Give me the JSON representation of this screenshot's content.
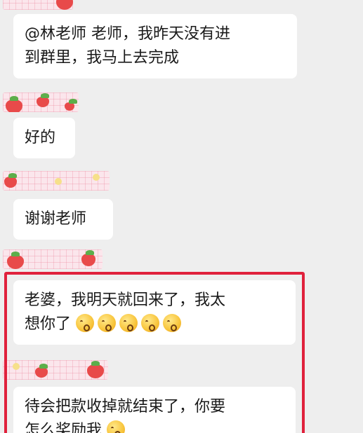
{
  "messages": [
    {
      "id": "m1",
      "text_lines": [
        "@林老师 老师，我昨天没有进",
        "到群里，我马上去完成"
      ]
    },
    {
      "id": "m2",
      "text_lines": [
        "好的"
      ]
    },
    {
      "id": "m3",
      "text_lines": [
        "谢谢老师"
      ]
    },
    {
      "id": "m4",
      "text_lines": [
        "老婆，我明天就回来了，我太",
        "想你了"
      ],
      "emoji_name": "kissing-face-emoji",
      "emoji_count": 5
    },
    {
      "id": "m5",
      "text_lines": [
        "待会把款收掉就结束了，你要",
        "怎么奖励我"
      ],
      "emoji_name": "kissing-face-emoji",
      "emoji_count": 1
    }
  ],
  "decoration": {
    "strip_theme": "strawberry-gingham",
    "highlight_color": "#e0213c"
  }
}
